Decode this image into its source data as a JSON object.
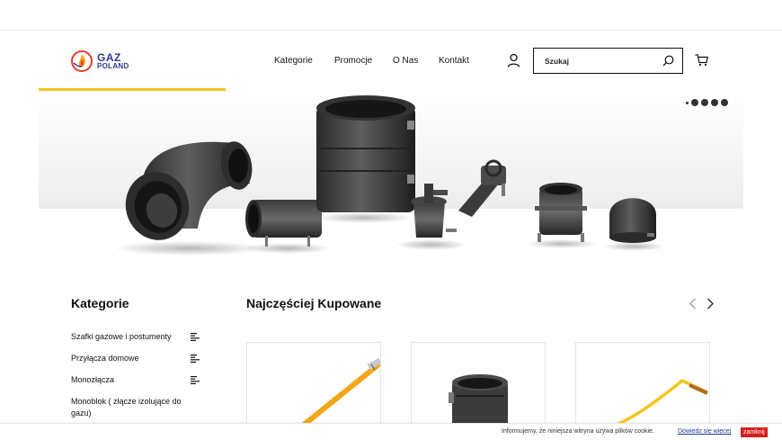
{
  "header": {
    "logo": {
      "line1": "GAZ",
      "line2": "POLAND"
    },
    "nav": [
      {
        "label": "Kategorie"
      },
      {
        "label": "Promocje"
      },
      {
        "label": "O Nas"
      },
      {
        "label": "Kontakt"
      }
    ],
    "search": {
      "placeholder": "Szukaj",
      "value": ""
    }
  },
  "hero": {
    "slides_count": 5,
    "active_slide": 1
  },
  "categories": {
    "title": "Kategorie",
    "items": [
      {
        "label": "Szafki gazowe i postumenty"
      },
      {
        "label": "Przyłącza domowe"
      },
      {
        "label": "Monozłącza"
      },
      {
        "label": "Monoblok ( złącze izolujące do gazu)"
      }
    ]
  },
  "bestsellers": {
    "title": "Najczęściej Kupowane"
  },
  "cookie": {
    "text": "Informujemy, że niniejsza witryna używa plików cookie.",
    "link": "Dowiedz się więcej",
    "close": "zamknij"
  },
  "colors": {
    "accent_yellow": "#f4c51a",
    "brand_blue": "#2a3a8f",
    "cookie_close_red": "#d61e1e"
  }
}
